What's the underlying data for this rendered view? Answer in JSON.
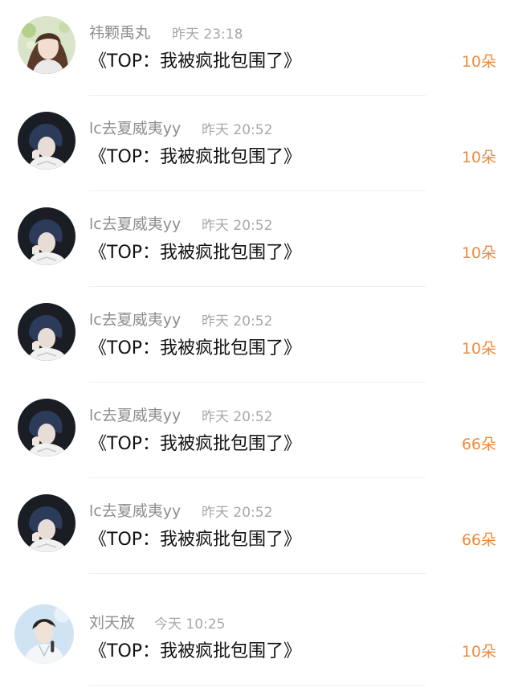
{
  "colors": {
    "name": "#8e8e8e",
    "time": "#a8a8a8",
    "message": "#111111",
    "count": "#f08a3a",
    "divider": "#eeeeee"
  },
  "comments": [
    {
      "avatar": "avatar-girl-icon",
      "name": "祎颗禹丸",
      "time": "昨天 23:18",
      "message": "《TOP：我被疯批包围了》",
      "count": "10朵"
    },
    {
      "avatar": "avatar-boy-dark-icon",
      "name": "lc去夏威夷yy",
      "time": "昨天 20:52",
      "message": "《TOP：我被疯批包围了》",
      "count": "10朵"
    },
    {
      "avatar": "avatar-boy-dark-icon",
      "name": "lc去夏威夷yy",
      "time": "昨天 20:52",
      "message": "《TOP：我被疯批包围了》",
      "count": "10朵"
    },
    {
      "avatar": "avatar-boy-dark-icon",
      "name": "lc去夏威夷yy",
      "time": "昨天 20:52",
      "message": "《TOP：我被疯批包围了》",
      "count": "10朵"
    },
    {
      "avatar": "avatar-boy-dark-icon",
      "name": "lc去夏威夷yy",
      "time": "昨天 20:52",
      "message": "《TOP：我被疯批包围了》",
      "count": "66朵"
    },
    {
      "avatar": "avatar-boy-dark-icon",
      "name": "lc去夏威夷yy",
      "time": "昨天 20:52",
      "message": "《TOP：我被疯批包围了》",
      "count": "66朵"
    },
    {
      "avatar": "avatar-boy-light-icon",
      "name": "刘天放",
      "time": "今天 10:25",
      "message": "《TOP：我被疯批包围了》",
      "count": "10朵"
    }
  ]
}
